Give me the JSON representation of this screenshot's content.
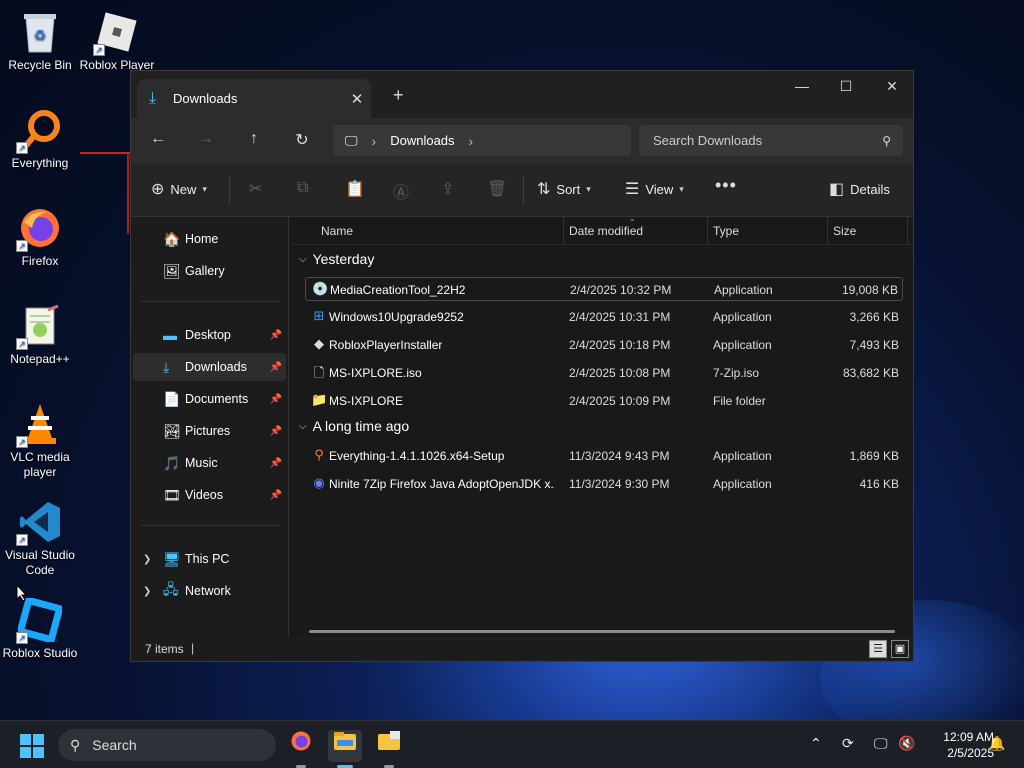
{
  "desktop": {
    "icons": [
      {
        "label": "Recycle Bin",
        "icon": "recycle-bin-icon"
      },
      {
        "label": "Roblox Player",
        "icon": "roblox-player-icon"
      },
      {
        "label": "Everything",
        "icon": "everything-icon"
      },
      {
        "label": "Firefox",
        "icon": "firefox-icon"
      },
      {
        "label": "Notepad++",
        "icon": "notepadpp-icon"
      },
      {
        "label": "VLC media player",
        "icon": "vlc-icon"
      },
      {
        "label": "Visual Studio Code",
        "icon": "vscode-icon"
      },
      {
        "label": "Roblox Studio",
        "icon": "roblox-studio-icon"
      }
    ]
  },
  "explorer": {
    "tab_title": "Downloads",
    "address": {
      "path": [
        "Downloads"
      ]
    },
    "search_placeholder": "Search Downloads",
    "commands": {
      "new": "New",
      "sort": "Sort",
      "view": "View",
      "details": "Details"
    },
    "nav": {
      "home": "Home",
      "gallery": "Gallery",
      "desktop": "Desktop",
      "downloads": "Downloads",
      "documents": "Documents",
      "pictures": "Pictures",
      "music": "Music",
      "videos": "Videos",
      "this_pc": "This PC",
      "network": "Network"
    },
    "columns": {
      "name": "Name",
      "date": "Date modified",
      "type": "Type",
      "size": "Size"
    },
    "groups": [
      {
        "label": "Yesterday",
        "files": [
          {
            "name": "MediaCreationTool_22H2",
            "date": "2/4/2025 10:32 PM",
            "type": "Application",
            "size": "19,008 KB",
            "icon": "media-creation-tool-icon"
          },
          {
            "name": "Windows10Upgrade9252",
            "date": "2/4/2025 10:31 PM",
            "type": "Application",
            "size": "3,266 KB",
            "icon": "windows-logo-icon"
          },
          {
            "name": "RobloxPlayerInstaller",
            "date": "2/4/2025 10:18 PM",
            "type": "Application",
            "size": "7,493 KB",
            "icon": "roblox-icon"
          },
          {
            "name": "MS-IXPLORE.iso",
            "date": "2/4/2025 10:08 PM",
            "type": "7-Zip.iso",
            "size": "83,682 KB",
            "icon": "file-icon"
          },
          {
            "name": "MS-IXPLORE",
            "date": "2/4/2025 10:09 PM",
            "type": "File folder",
            "size": "",
            "icon": "folder-icon"
          }
        ]
      },
      {
        "label": "A long time ago",
        "files": [
          {
            "name": "Everything-1.4.1.1026.x64-Setup",
            "date": "11/3/2024 9:43 PM",
            "type": "Application",
            "size": "1,869 KB",
            "icon": "everything-icon"
          },
          {
            "name": "Ninite 7Zip Firefox Java AdoptOpenJDK x...",
            "date": "11/3/2024 9:30 PM",
            "type": "Application",
            "size": "416 KB",
            "icon": "ninite-icon"
          }
        ]
      }
    ],
    "status": {
      "item_count": "7 items",
      "caret": "|"
    }
  },
  "taskbar": {
    "search_label": "Search",
    "clock_time": "12:09 AM",
    "clock_date": "2/5/2025"
  },
  "colors": {
    "accent": "#4cc2ff",
    "window_bg": "#191919",
    "folder": "#f5c542"
  }
}
